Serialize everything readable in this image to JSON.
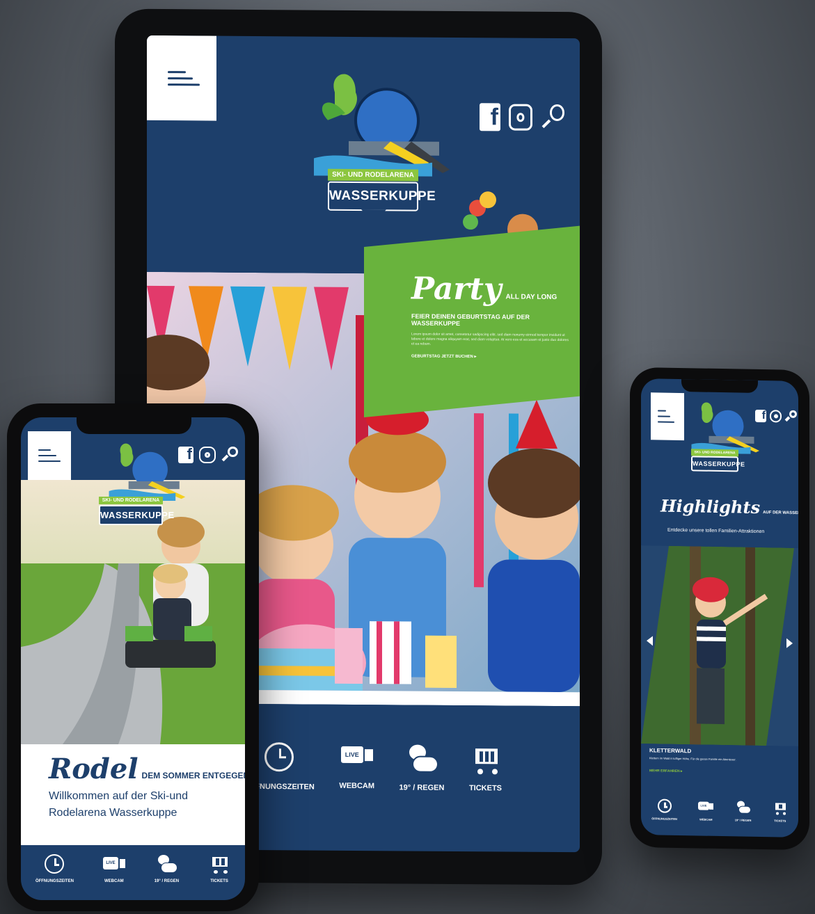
{
  "brand": {
    "top": "SKI- UND RODELARENA",
    "name": "WASSERKUPPE",
    "navy": "#1d3f6b",
    "green": "#8cc63f"
  },
  "icons": {
    "facebook": "f",
    "live": "LIVE"
  },
  "tablet": {
    "party": {
      "title": "Party",
      "tag": "ALL DAY LONG",
      "subtitle": "FEIER DEINEN GEBURTSTAG AUF DER WASSERKUPPE",
      "body": "Lorem ipsum dolor sit amet, consetetur sadipscing elitr, sed diam nonumy eirmod tempor invidunt ut labore et dolore magna aliquyam erat, sed diam voluptua. At vero eos et accusam et justo duo dolores et ea rebum.",
      "link": "GEBURTSTAG JETZT BUCHEN ▸"
    },
    "bar": [
      "ÖFFNUNGSZEITEN",
      "WEBCAM",
      "19° / REGEN",
      "TICKETS"
    ]
  },
  "phone_left": {
    "title": "Rodel",
    "tag": "DEM SOMMER ENTGEGEN!",
    "line1": "Willkommen auf der Ski-und",
    "line2": "Rodelarena Wasserkuppe",
    "bar": [
      "ÖFFNUNGSZEITEN",
      "WEBCAM",
      "19° / REGEN",
      "TICKETS"
    ]
  },
  "phone_right": {
    "title": "Highlights",
    "tag": "AUF DER WASSERKUPPE",
    "subtitle": "Entdecke unsere tollen Familien-Attraktionen",
    "slide_title": "KLETTERWALD",
    "slide_text": "Klettern im Wald in luftiger Höhe. Für die ganze Familie ein Abenteuer.",
    "slide_link": "MEHR ERFAHREN ▸",
    "bar": [
      "ÖFFNUNGSZEITEN",
      "WEBCAM",
      "19° / REGEN",
      "TICKETS"
    ]
  }
}
